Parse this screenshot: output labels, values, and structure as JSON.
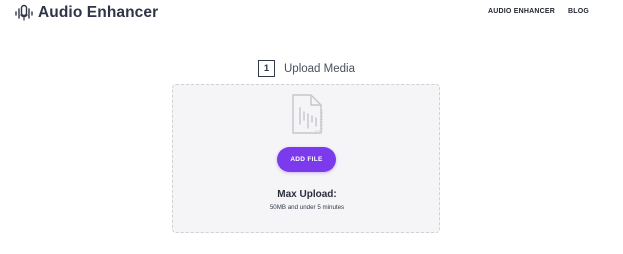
{
  "header": {
    "brand_name": "Audio Enhancer",
    "brand_icon": "audio-waveform-icon",
    "nav": [
      {
        "label": "AUDIO ENHANCER"
      },
      {
        "label": "BLOG"
      }
    ]
  },
  "upload": {
    "step_number": "1",
    "step_label": "Upload Media",
    "file_icon": "audio-file-icon",
    "add_file_label": "ADD FILE",
    "max_upload_title": "Max Upload:",
    "max_upload_detail": "50MB and under 5 minutes"
  },
  "colors": {
    "accent": "#7c3aed",
    "text_dark": "#2f3547",
    "dropzone_bg": "#f5f5f7"
  }
}
